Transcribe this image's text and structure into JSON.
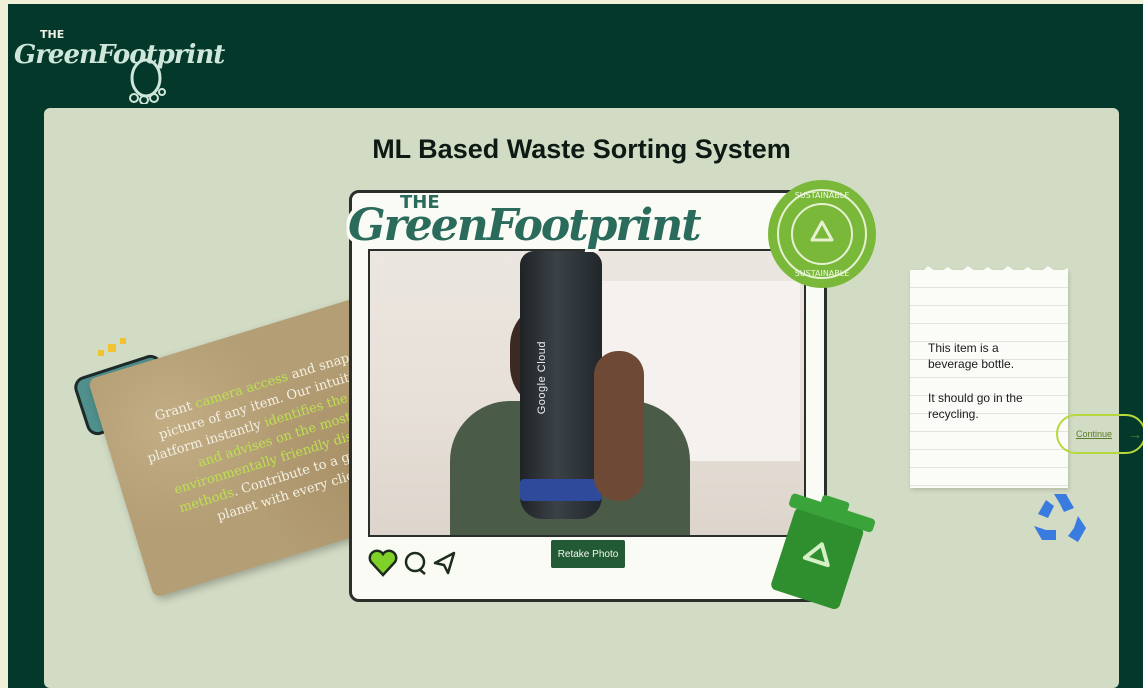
{
  "brand": {
    "the": "THE",
    "name": "GreenFootprint"
  },
  "page": {
    "title": "ML Based Waste Sorting System"
  },
  "photo_card": {
    "bottle_label": "Google Cloud",
    "retake_label": "Retake Photo",
    "seal_text": "SUSTAINABLE"
  },
  "cardboard": {
    "parts": [
      {
        "text": "Grant ",
        "highlight": false
      },
      {
        "text": "camera access",
        "highlight": true
      },
      {
        "text": " and snap a picture of any item. Our intuitive platform instantly ",
        "highlight": false
      },
      {
        "text": "identifies the object and advises on the most environmentally friendly disposal methods",
        "highlight": true
      },
      {
        "text": ". Contribute to a greener planet with every click.",
        "highlight": false
      }
    ]
  },
  "result_note": {
    "line1": "This item is a beverage bottle.",
    "line2": "It should go in the recycling."
  },
  "next": {
    "label": "Continue"
  },
  "colors": {
    "bg": "#03382a",
    "panel": "#d2dbc4",
    "accent": "#b7d83d",
    "button": "#215a35"
  },
  "icons": [
    "heart-icon",
    "comment-icon",
    "share-icon",
    "camera-icon",
    "recycle-bin-icon",
    "recycle-icon",
    "sustainable-seal-icon"
  ]
}
